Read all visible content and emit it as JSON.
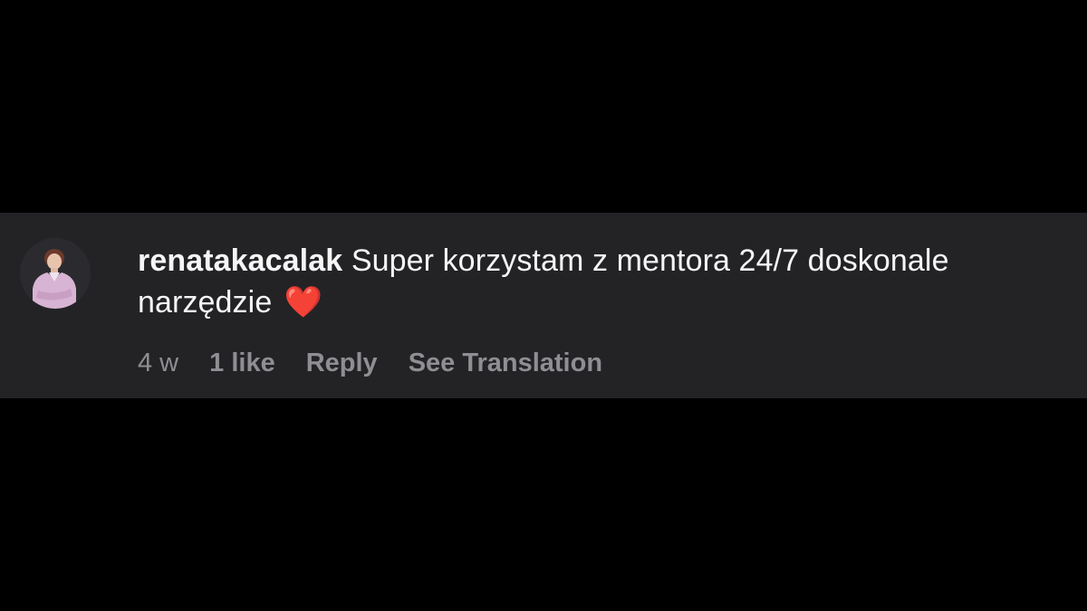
{
  "comment": {
    "username": "renatakacalak",
    "text": "Super korzystam z mentora 24/7 doskonale narzędzie",
    "emoji": "❤️",
    "avatar_icon": "user-avatar-photo"
  },
  "meta": {
    "timestamp": "4 w",
    "likes": "1 like",
    "reply_label": "Reply",
    "translate_label": "See Translation"
  },
  "colors": {
    "background": "#000000",
    "card": "#232326",
    "text": "#f5f5f5",
    "meta": "#8e8e93"
  }
}
